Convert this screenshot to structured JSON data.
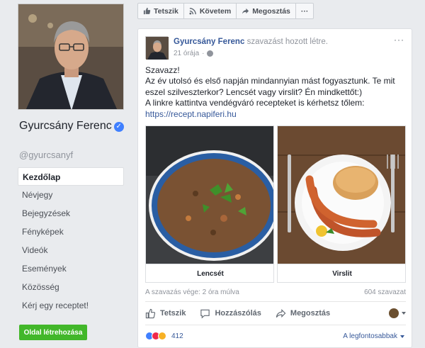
{
  "profile": {
    "name": "Gyurcsány Ferenc",
    "handle": "@gyurcsanyf"
  },
  "nav": [
    {
      "label": "Kezdőlap",
      "active": true
    },
    {
      "label": "Névjegy"
    },
    {
      "label": "Bejegyzések"
    },
    {
      "label": "Fényképek"
    },
    {
      "label": "Videók"
    },
    {
      "label": "Események"
    },
    {
      "label": "Közösség"
    },
    {
      "label": "Kérj egy receptet!"
    }
  ],
  "create_page_label": "Oldal létrehozása",
  "actionbar": {
    "like": "Tetszik",
    "follow": "Követem",
    "share": "Megosztás",
    "more": "···"
  },
  "post": {
    "author": "Gyurcsány Ferenc",
    "action": "szavazást hozott létre.",
    "time": "21 órája",
    "menu": "···",
    "lines": [
      "Szavazz!",
      "Az év utolsó és első napján mindannyian mást fogyasztunk. Te mit eszel szilveszterkor? Lencsét vagy virslit? Én mindkettőt:)",
      "A linkre kattintva vendégváró recepteket is kérhetsz tőlem:"
    ],
    "link": "https://recept.napiferi.hu",
    "poll": {
      "options": [
        {
          "label": "Lencsét"
        },
        {
          "label": "Virslit"
        }
      ],
      "ends": "A szavazás vége: 2 óra múlva",
      "votes": "604 szavazat"
    },
    "actions": {
      "like": "Tetszik",
      "comment": "Hozzászólás",
      "share": "Megosztás"
    },
    "reactions_count": "412",
    "sort_label": "A legfontosabbak"
  },
  "colors": {
    "link": "#365899",
    "green_button": "#42b72a",
    "background": "#e9ebee"
  }
}
